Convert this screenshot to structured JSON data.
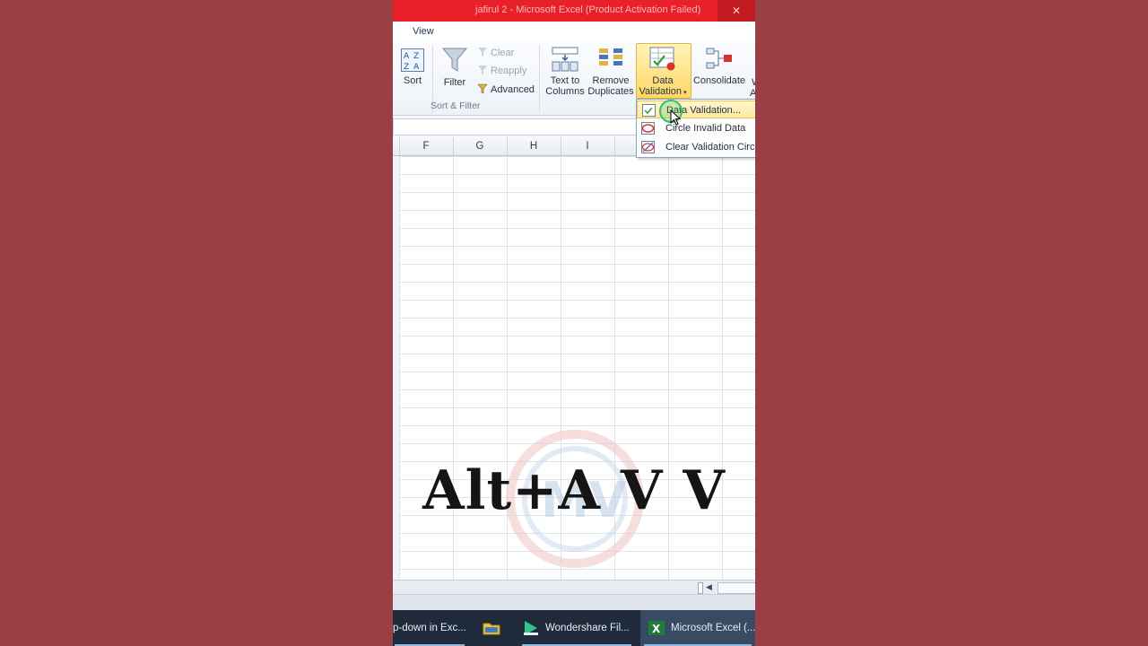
{
  "window": {
    "title": "jafirul 2 - Microsoft Excel (Product Activation Failed)"
  },
  "ribbon": {
    "tab_visible": "View",
    "sort_label": "Sort",
    "filter_label": "Filter",
    "clear_label": "Clear",
    "reapply_label": "Reapply",
    "advanced_label": "Advanced",
    "sort_filter_group": "Sort & Filter",
    "text_to_columns_line1": "Text to",
    "text_to_columns_line2": "Columns",
    "remove_duplicates_line1": "Remove",
    "remove_duplicates_line2": "Duplicates",
    "data_validation_line1": "Data",
    "data_validation_line2": "Validation",
    "consolidate_label": "Consolidate",
    "partial_label_1": "W",
    "partial_label_2": "A"
  },
  "dropdown": {
    "items": [
      {
        "label": "Data Validation..."
      },
      {
        "label": "Circle Invalid Data"
      },
      {
        "label": "Clear Validation Circles"
      }
    ]
  },
  "columns": [
    "F",
    "G",
    "H",
    "I"
  ],
  "overlay": {
    "shortcut": "Alt+A V V"
  },
  "taskbar": {
    "items": [
      {
        "label": "p-down in Exc..."
      },
      {
        "label": ""
      },
      {
        "label": "Wondershare Fil..."
      },
      {
        "label": "Microsoft Excel (..."
      }
    ]
  },
  "colors": {
    "title_bar": "#e8202a",
    "background": "#9a4044",
    "highlight": "#ffd765",
    "taskbar": "#1f2a3a"
  }
}
